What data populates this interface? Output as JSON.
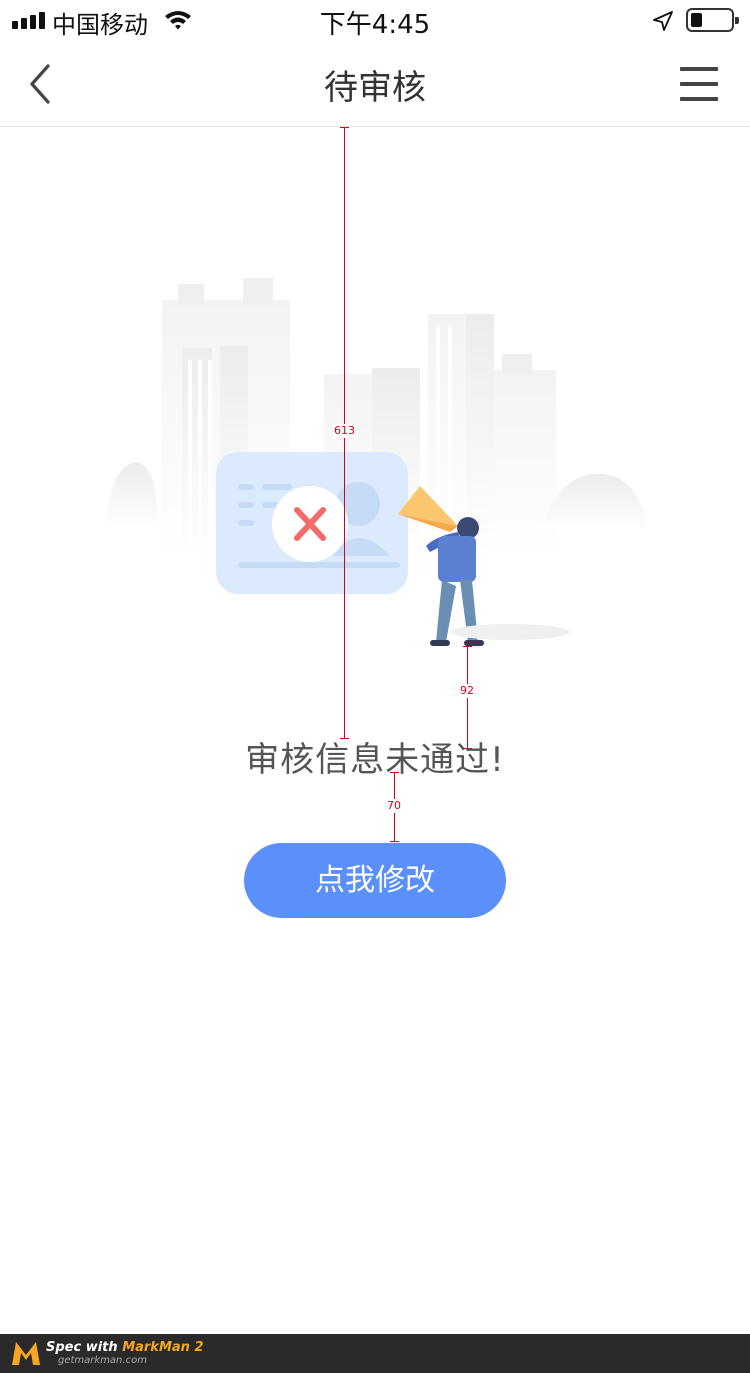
{
  "status_bar": {
    "carrier": "中国移动",
    "time": "下午4:45"
  },
  "nav": {
    "title": "待审核",
    "back_icon": "chevron-left-icon",
    "menu_icon": "hamburger-menu-icon"
  },
  "illustration": {
    "icon": "rejected-id-card-illustration"
  },
  "measurements": {
    "top_to_text": "613",
    "figure_to_text": "92",
    "text_to_button": "70"
  },
  "main": {
    "message": "审核信息未通过!",
    "edit_button_label": "点我修改"
  },
  "footer": {
    "spec_prefix": "Spec with ",
    "brand": "MarkMan 2",
    "site": "getmarkman.com"
  },
  "colors": {
    "accent": "#5b8ff9",
    "reject": "#f26b6b",
    "measure": "#d0021b"
  }
}
